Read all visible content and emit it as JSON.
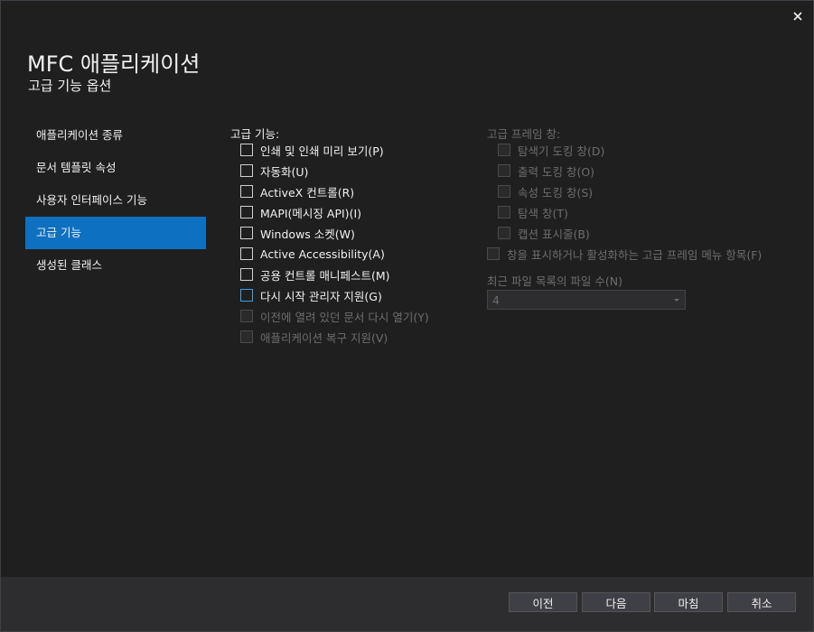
{
  "dialog": {
    "title": "MFC 애플리케이션",
    "subtitle": "고급 기능 옵션",
    "close_icon": "close-icon"
  },
  "nav": {
    "items": [
      {
        "label": "애플리케이션 종류"
      },
      {
        "label": "문서 템플릿 속성"
      },
      {
        "label": "사용자 인터페이스 기능"
      },
      {
        "label": "고급 기능"
      },
      {
        "label": "생성된 클래스"
      }
    ],
    "active_index": 3
  },
  "advanced": {
    "label": "고급 기능:",
    "options": [
      {
        "label": "인쇄 및 인쇄 미리 보기(P)",
        "checked": false
      },
      {
        "label": "자동화(U)",
        "checked": false
      },
      {
        "label": "ActiveX 컨트롤(R)",
        "checked": false
      },
      {
        "label": "MAPI(메시징 API)(I)",
        "checked": false
      },
      {
        "label": "Windows 소켓(W)",
        "checked": false
      },
      {
        "label": "Active Accessibility(A)",
        "checked": false
      },
      {
        "label": "공용 컨트롤 매니페스트(M)",
        "checked": false
      },
      {
        "label": "다시 시작 관리자 지원(G)",
        "checked": false
      },
      {
        "label": "이전에 열려 있던 문서 다시 열기(Y)",
        "checked": false
      },
      {
        "label": "애플리케이션 복구 지원(V)",
        "checked": false
      }
    ]
  },
  "frame": {
    "label": "고급 프레임 창:",
    "options": [
      {
        "label": "탐색기 도킹 창(D)"
      },
      {
        "label": "출력 도킹 창(O)"
      },
      {
        "label": "속성 도킹 창(S)"
      },
      {
        "label": "탐색 창(T)"
      },
      {
        "label": "캡션 표시줄(B)"
      }
    ],
    "menu_option": "창을 표시하거나 활성화하는 고급 프레임 메뉴 항목(F)"
  },
  "recent": {
    "label": "최근 파일 목록의 파일 수(N)",
    "value": "4"
  },
  "footer": {
    "prev": "이전",
    "next": "다음",
    "finish": "마침",
    "cancel": "취소"
  },
  "colors": {
    "background": "#1f1f1f",
    "footer": "#2d2d30",
    "accent": "#0e70c0",
    "focus": "#3f9fe8"
  }
}
